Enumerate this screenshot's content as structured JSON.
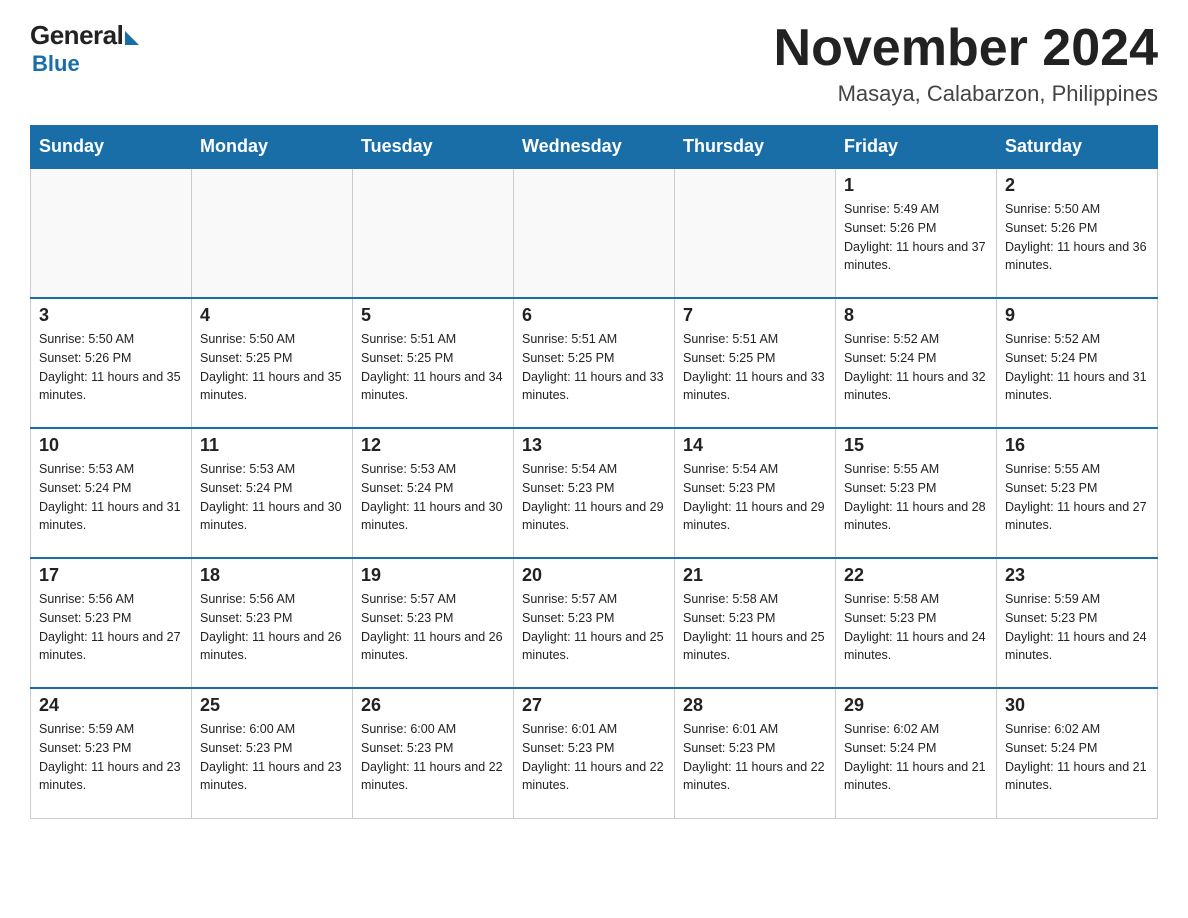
{
  "header": {
    "logo_general": "General",
    "logo_blue": "Blue",
    "month_year": "November 2024",
    "location": "Masaya, Calabarzon, Philippines"
  },
  "weekdays": [
    "Sunday",
    "Monday",
    "Tuesday",
    "Wednesday",
    "Thursday",
    "Friday",
    "Saturday"
  ],
  "weeks": [
    [
      {
        "day": "",
        "info": ""
      },
      {
        "day": "",
        "info": ""
      },
      {
        "day": "",
        "info": ""
      },
      {
        "day": "",
        "info": ""
      },
      {
        "day": "",
        "info": ""
      },
      {
        "day": "1",
        "info": "Sunrise: 5:49 AM\nSunset: 5:26 PM\nDaylight: 11 hours and 37 minutes."
      },
      {
        "day": "2",
        "info": "Sunrise: 5:50 AM\nSunset: 5:26 PM\nDaylight: 11 hours and 36 minutes."
      }
    ],
    [
      {
        "day": "3",
        "info": "Sunrise: 5:50 AM\nSunset: 5:26 PM\nDaylight: 11 hours and 35 minutes."
      },
      {
        "day": "4",
        "info": "Sunrise: 5:50 AM\nSunset: 5:25 PM\nDaylight: 11 hours and 35 minutes."
      },
      {
        "day": "5",
        "info": "Sunrise: 5:51 AM\nSunset: 5:25 PM\nDaylight: 11 hours and 34 minutes."
      },
      {
        "day": "6",
        "info": "Sunrise: 5:51 AM\nSunset: 5:25 PM\nDaylight: 11 hours and 33 minutes."
      },
      {
        "day": "7",
        "info": "Sunrise: 5:51 AM\nSunset: 5:25 PM\nDaylight: 11 hours and 33 minutes."
      },
      {
        "day": "8",
        "info": "Sunrise: 5:52 AM\nSunset: 5:24 PM\nDaylight: 11 hours and 32 minutes."
      },
      {
        "day": "9",
        "info": "Sunrise: 5:52 AM\nSunset: 5:24 PM\nDaylight: 11 hours and 31 minutes."
      }
    ],
    [
      {
        "day": "10",
        "info": "Sunrise: 5:53 AM\nSunset: 5:24 PM\nDaylight: 11 hours and 31 minutes."
      },
      {
        "day": "11",
        "info": "Sunrise: 5:53 AM\nSunset: 5:24 PM\nDaylight: 11 hours and 30 minutes."
      },
      {
        "day": "12",
        "info": "Sunrise: 5:53 AM\nSunset: 5:24 PM\nDaylight: 11 hours and 30 minutes."
      },
      {
        "day": "13",
        "info": "Sunrise: 5:54 AM\nSunset: 5:23 PM\nDaylight: 11 hours and 29 minutes."
      },
      {
        "day": "14",
        "info": "Sunrise: 5:54 AM\nSunset: 5:23 PM\nDaylight: 11 hours and 29 minutes."
      },
      {
        "day": "15",
        "info": "Sunrise: 5:55 AM\nSunset: 5:23 PM\nDaylight: 11 hours and 28 minutes."
      },
      {
        "day": "16",
        "info": "Sunrise: 5:55 AM\nSunset: 5:23 PM\nDaylight: 11 hours and 27 minutes."
      }
    ],
    [
      {
        "day": "17",
        "info": "Sunrise: 5:56 AM\nSunset: 5:23 PM\nDaylight: 11 hours and 27 minutes."
      },
      {
        "day": "18",
        "info": "Sunrise: 5:56 AM\nSunset: 5:23 PM\nDaylight: 11 hours and 26 minutes."
      },
      {
        "day": "19",
        "info": "Sunrise: 5:57 AM\nSunset: 5:23 PM\nDaylight: 11 hours and 26 minutes."
      },
      {
        "day": "20",
        "info": "Sunrise: 5:57 AM\nSunset: 5:23 PM\nDaylight: 11 hours and 25 minutes."
      },
      {
        "day": "21",
        "info": "Sunrise: 5:58 AM\nSunset: 5:23 PM\nDaylight: 11 hours and 25 minutes."
      },
      {
        "day": "22",
        "info": "Sunrise: 5:58 AM\nSunset: 5:23 PM\nDaylight: 11 hours and 24 minutes."
      },
      {
        "day": "23",
        "info": "Sunrise: 5:59 AM\nSunset: 5:23 PM\nDaylight: 11 hours and 24 minutes."
      }
    ],
    [
      {
        "day": "24",
        "info": "Sunrise: 5:59 AM\nSunset: 5:23 PM\nDaylight: 11 hours and 23 minutes."
      },
      {
        "day": "25",
        "info": "Sunrise: 6:00 AM\nSunset: 5:23 PM\nDaylight: 11 hours and 23 minutes."
      },
      {
        "day": "26",
        "info": "Sunrise: 6:00 AM\nSunset: 5:23 PM\nDaylight: 11 hours and 22 minutes."
      },
      {
        "day": "27",
        "info": "Sunrise: 6:01 AM\nSunset: 5:23 PM\nDaylight: 11 hours and 22 minutes."
      },
      {
        "day": "28",
        "info": "Sunrise: 6:01 AM\nSunset: 5:23 PM\nDaylight: 11 hours and 22 minutes."
      },
      {
        "day": "29",
        "info": "Sunrise: 6:02 AM\nSunset: 5:24 PM\nDaylight: 11 hours and 21 minutes."
      },
      {
        "day": "30",
        "info": "Sunrise: 6:02 AM\nSunset: 5:24 PM\nDaylight: 11 hours and 21 minutes."
      }
    ]
  ]
}
